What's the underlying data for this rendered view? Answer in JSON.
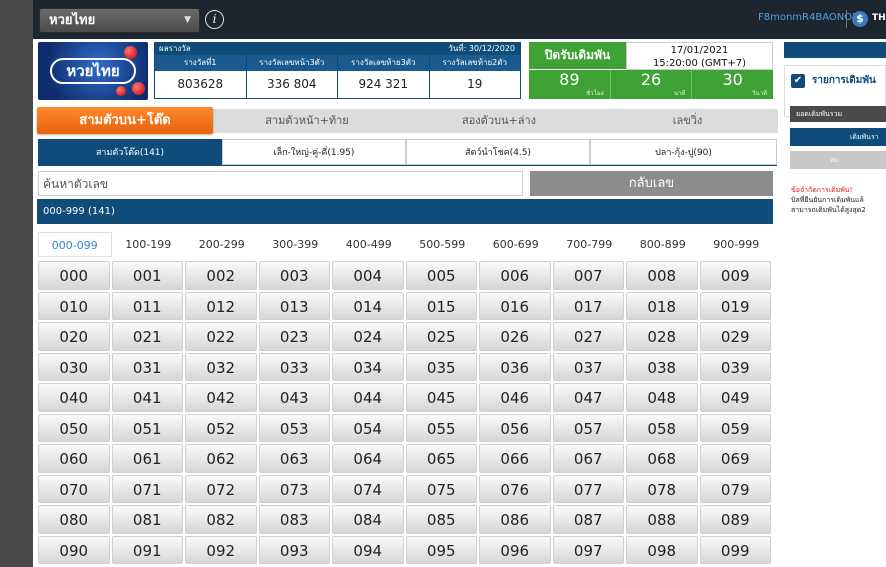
{
  "header": {
    "lottery_name": "หวยไทย",
    "username": "F8monmR4BAONOD",
    "theme_label": "THE"
  },
  "logo": {
    "text": "หวยไทย"
  },
  "results": {
    "title": "ผลรางวัล",
    "date_label": "วันที่: 30/12/2020",
    "columns": [
      {
        "label": "รางวัลที่1",
        "value": "803628"
      },
      {
        "label": "รางวัลเลขหน้า3ตัว",
        "value": "336  804"
      },
      {
        "label": "รางวัลเลขท้าย3ตัว",
        "value": "924  321"
      },
      {
        "label": "รางวัลเลขท้าย2ตัว",
        "value": "19"
      }
    ]
  },
  "betting": {
    "close_label": "ปิดรับเดิมพัน",
    "date": "17/01/2021",
    "time": "15:20:00 (GMT+7)",
    "countdown": [
      {
        "value": "89",
        "unit": "ชั่วโมง"
      },
      {
        "value": "26",
        "unit": "นาที"
      },
      {
        "value": "30",
        "unit": "วินาที"
      }
    ]
  },
  "sub_tabs": [
    "สามตัวบน+โต๊ด",
    "สามตัวหน้า+ท้าย",
    "สองตัวบน+ล่าง",
    "เลขวิ่ง"
  ],
  "bet_tabs": [
    "สามตัวโต๊ด(141)",
    "เล็ก-ใหญ่-คู่-คี่(1.95)",
    "สัตว์นำโชค(4.5)",
    "ปลา-กุ้ง-ปู(90)"
  ],
  "search": {
    "placeholder": "ค้นหาตัวเลข",
    "reverse_label": "กลับเลข"
  },
  "range_label": "000-999 (141)",
  "hundreds_tabs": [
    "000-099",
    "100-199",
    "200-299",
    "300-399",
    "400-499",
    "500-599",
    "600-699",
    "700-799",
    "800-899",
    "900-999"
  ],
  "numbers": [
    [
      "000",
      "001",
      "002",
      "003",
      "004",
      "005",
      "006",
      "007",
      "008",
      "009"
    ],
    [
      "010",
      "011",
      "012",
      "013",
      "014",
      "015",
      "016",
      "017",
      "018",
      "019"
    ],
    [
      "020",
      "021",
      "022",
      "023",
      "024",
      "025",
      "026",
      "027",
      "028",
      "029"
    ],
    [
      "030",
      "031",
      "032",
      "033",
      "034",
      "035",
      "036",
      "037",
      "038",
      "039"
    ],
    [
      "040",
      "041",
      "042",
      "043",
      "044",
      "045",
      "046",
      "047",
      "048",
      "049"
    ],
    [
      "050",
      "051",
      "052",
      "053",
      "054",
      "055",
      "056",
      "057",
      "058",
      "059"
    ],
    [
      "060",
      "061",
      "062",
      "063",
      "064",
      "065",
      "066",
      "067",
      "068",
      "069"
    ],
    [
      "070",
      "071",
      "072",
      "073",
      "074",
      "075",
      "076",
      "077",
      "078",
      "079"
    ],
    [
      "080",
      "081",
      "082",
      "083",
      "084",
      "085",
      "086",
      "087",
      "088",
      "089"
    ],
    [
      "090",
      "091",
      "092",
      "093",
      "094",
      "095",
      "096",
      "097",
      "098",
      "099"
    ]
  ],
  "right_panel": {
    "list_label": "รายการเดิมพัน",
    "total_label": "ยอดเดิมพันรวม",
    "add_label": "เดิมพันรา",
    "delete_label": "ลบ",
    "note_red": "ข้อจำกัดการเดิมพัน!",
    "note_line1": "บิลที่ยืนยันการเดิมพันแล้",
    "note_line2": "สามารถเดิมพันได้สูงสุด2"
  },
  "colors": {
    "navy": "#0f4c7a",
    "green": "#3fa235",
    "orange": "#e8620b",
    "topbar": "#1d252e"
  }
}
